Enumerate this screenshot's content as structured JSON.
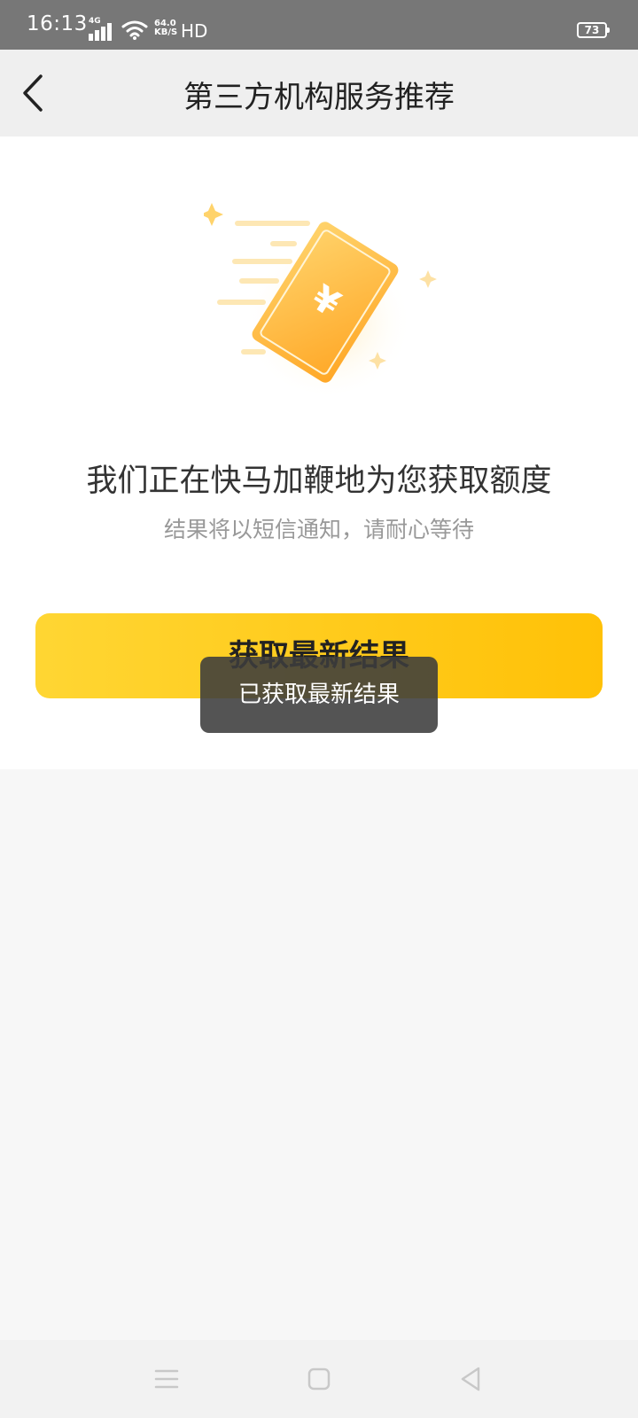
{
  "status_bar": {
    "time": "16:13",
    "network": "4G",
    "speed_value": "64.0",
    "speed_unit": "KB/S",
    "hd": "HD",
    "battery": "73"
  },
  "header": {
    "title": "第三方机构服务推荐"
  },
  "main": {
    "message": "我们正在快马加鞭地为您获取额度",
    "sub_message": "结果将以短信通知，请耐心等待",
    "refresh_button_label": "获取最新结果",
    "card_symbol": "¥"
  },
  "toast": {
    "text": "已获取最新结果"
  },
  "colors": {
    "accent": "#ffc107",
    "accent_light": "#ffd633",
    "status_bar": "#777777",
    "header_bg": "#efefef"
  },
  "icons": {
    "back": "back-icon",
    "menu": "menu-icon",
    "home": "home-icon",
    "recent": "back-triangle-icon"
  }
}
